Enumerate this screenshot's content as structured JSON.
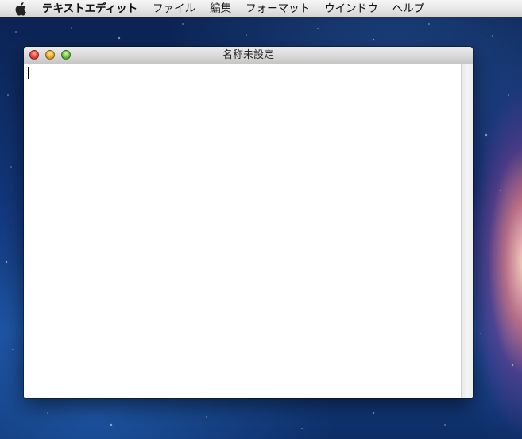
{
  "menubar": {
    "apple_icon": "apple-icon",
    "app_name": "テキストエディット",
    "items": [
      "ファイル",
      "編集",
      "フォーマット",
      "ウインドウ",
      "ヘルプ"
    ]
  },
  "window": {
    "title": "名称未設定",
    "buttons": [
      "close",
      "minimize",
      "zoom"
    ],
    "document_text": ""
  }
}
